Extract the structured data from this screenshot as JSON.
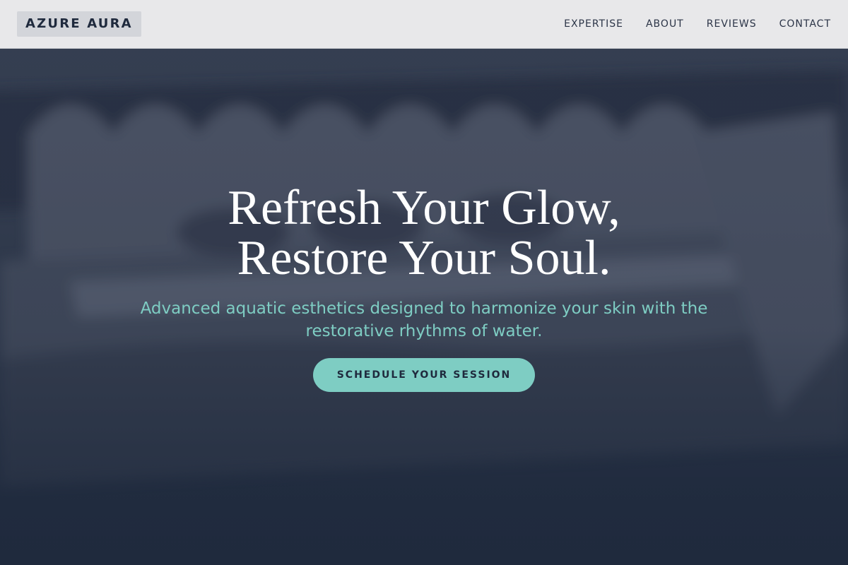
{
  "header": {
    "logo": "AZURE AURA",
    "nav": [
      "EXPERTISE",
      "ABOUT",
      "REVIEWS",
      "CONTACT"
    ]
  },
  "hero": {
    "title_line1": "Refresh Your Glow,",
    "title_line2": "Restore Your Soul.",
    "subtitle": "Advanced aquatic esthetics designed to harmonize your skin with the restorative rhythms of water.",
    "cta_label": "SCHEDULE YOUR SESSION",
    "background_image": "blurred-beauty-tools-photo"
  },
  "colors": {
    "header_bg": "#e8e8ea",
    "logo_bg": "#d3d5da",
    "navy": "#1f2a3d",
    "accent": "#7ecdc3",
    "white": "#ffffff"
  }
}
